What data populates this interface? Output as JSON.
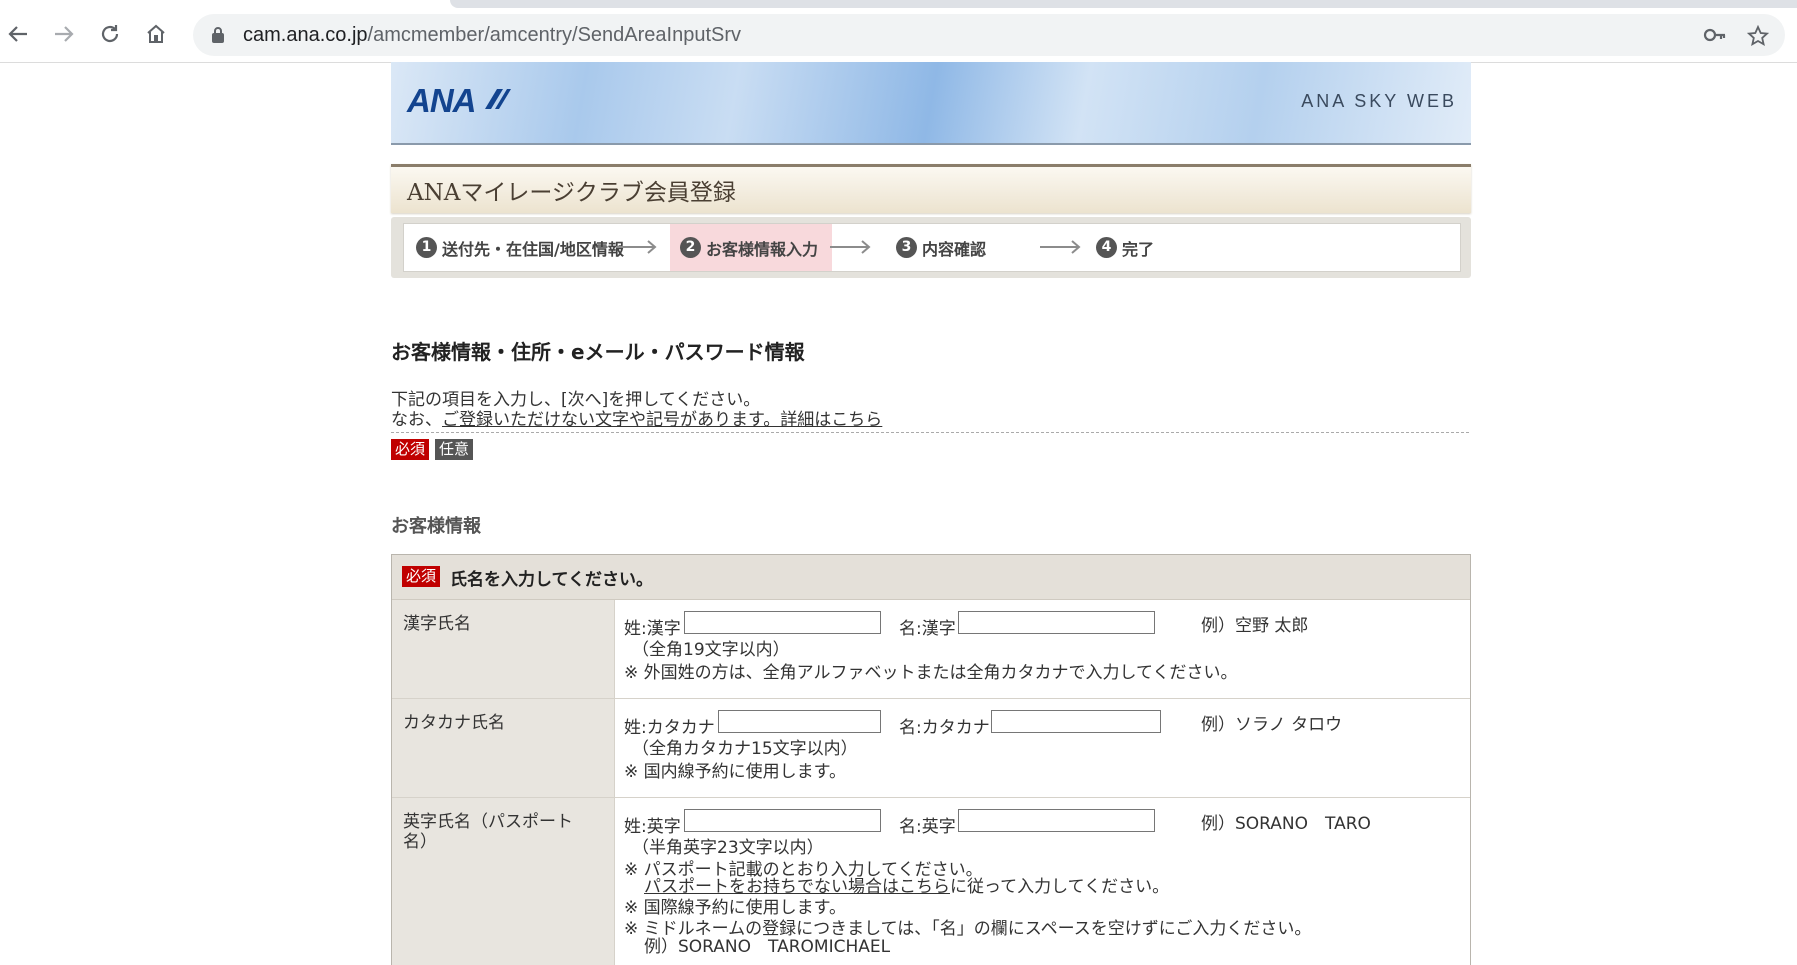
{
  "browser": {
    "url_host": "cam.ana.co.jp",
    "url_path": "/amcmember/amcentry/SendAreaInputSrv"
  },
  "banner": {
    "logo": "ANA",
    "site_name": "ANA SKY WEB"
  },
  "page_title": "ANAマイレージクラブ会員登録",
  "steps": [
    {
      "num": "1",
      "label": "送付先・在住国/地区情報"
    },
    {
      "num": "2",
      "label": "お客様情報入力"
    },
    {
      "num": "3",
      "label": "内容確認"
    },
    {
      "num": "4",
      "label": "完了"
    }
  ],
  "section_title": "お客様情報・住所・eメール・パスワード情報",
  "intro": {
    "line1": "下記の項目を入力し、[次へ]を押してください。",
    "line2_prefix": "なお、",
    "line2_link": "ご登録いただけない文字や記号があります。詳細はこちら"
  },
  "legend": {
    "required": "必須",
    "optional": "任意"
  },
  "subsection_title": "お客様情報",
  "form": {
    "header_tag": "必須",
    "header_text": "氏名を入力してください。",
    "rows": [
      {
        "label": "漢字氏名",
        "last_label": "姓:漢字",
        "first_label": "名:漢字",
        "last_value": "",
        "first_value": "",
        "example": "例）空野 太郎",
        "limit": "（全角19文字以内）",
        "note": "※ 外国姓の方は、全角アルファベットまたは全角カタカナで入力してください。"
      },
      {
        "label": "カタカナ氏名",
        "last_label": "姓:カタカナ",
        "first_label": "名:カタカナ",
        "last_value": "",
        "first_value": "",
        "example": "例）ソラノ タロウ",
        "limit": "（全角カタカナ15文字以内）",
        "note": "※ 国内線予約に使用します。"
      },
      {
        "label": "英字氏名（パスポート名）",
        "last_label": "姓:英字",
        "first_label": "名:英字",
        "last_value": "",
        "first_value": "",
        "example": "例）SORANO　TARO",
        "limit": "（半角英字23文字以内）",
        "notes": {
          "n1": "※ パスポート記載のとおり入力してください。",
          "n1b_link": "パスポートをお持ちでない場合はこちら",
          "n1b_suffix": "に従って入力してください。",
          "n2": "※ 国際線予約に使用します。",
          "n3": "※ ミドルネームの登録につきましては、「名」の欄にスペースを空けずにご入力ください。",
          "n3b": "例）SORANO　TAROMICHAEL"
        }
      }
    ]
  }
}
